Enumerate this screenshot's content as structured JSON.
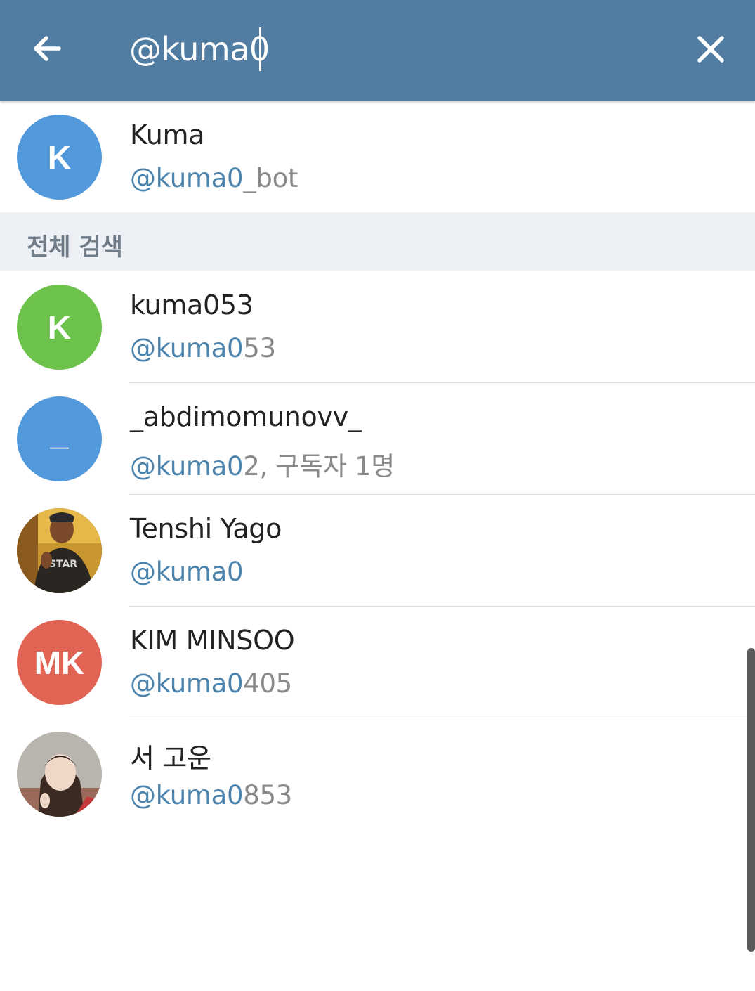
{
  "header": {
    "search_value": "@kuma0",
    "back_icon": "arrow-left-icon",
    "close_icon": "close-icon"
  },
  "top_result": {
    "name": "Kuma",
    "handle_match": "@kuma0",
    "handle_rest": "_bot",
    "avatar_letter": "K",
    "avatar_color": "#5299dc"
  },
  "section_title": "전체 검색",
  "results": [
    {
      "name": "kuma053",
      "handle_match": "@kuma0",
      "handle_rest": "53",
      "avatar_letter": "K",
      "avatar_color": "#6cc24a"
    },
    {
      "name": "_abdimomunovv_",
      "handle_match": "@kuma0",
      "handle_rest": "2, 구독자 1명",
      "avatar_letter": "_",
      "avatar_color": "#5299dc"
    },
    {
      "name": "Tenshi Yago",
      "handle_match": "@kuma0",
      "handle_rest": "",
      "avatar_letter": "",
      "avatar_color": "#6b4a2a"
    },
    {
      "name": "KIM MINSOO",
      "handle_match": "@kuma0",
      "handle_rest": "405",
      "avatar_letter": "MK",
      "avatar_color": "#e06354"
    },
    {
      "name": "서 고운",
      "handle_match": "@kuma0",
      "handle_rest": "853",
      "avatar_letter": "",
      "avatar_color": "#c9b6a8"
    }
  ],
  "colors": {
    "header_bg": "#527da3",
    "highlight": "#4d84ad",
    "section_bg": "#edf1f5"
  }
}
